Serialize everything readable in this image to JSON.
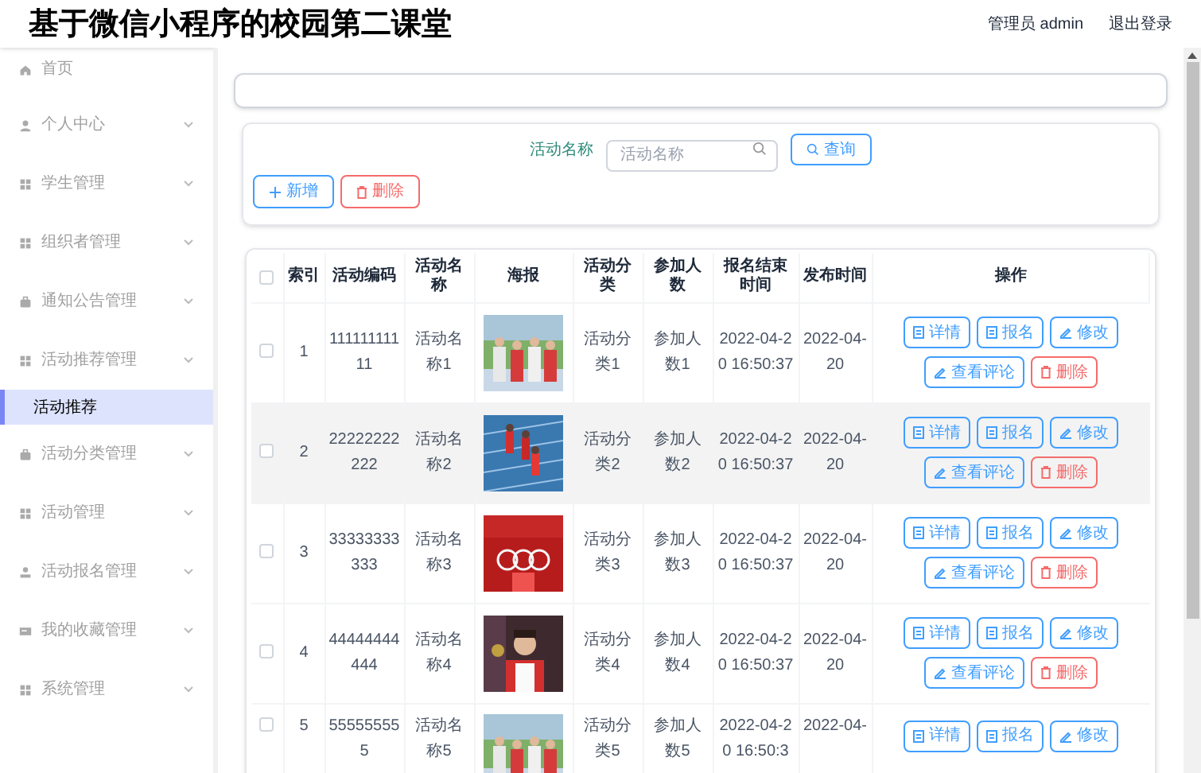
{
  "header": {
    "title": "基于微信小程序的校园第二课堂",
    "user": "管理员 admin",
    "logout": "退出登录"
  },
  "sidebar": {
    "items": [
      {
        "label": "首页",
        "kind": "home",
        "expandable": false
      },
      {
        "label": "个人中心",
        "kind": "user",
        "expandable": true
      },
      {
        "label": "学生管理",
        "kind": "grid",
        "expandable": true
      },
      {
        "label": "组织者管理",
        "kind": "grid",
        "expandable": true
      },
      {
        "label": "通知公告管理",
        "kind": "bag",
        "expandable": true
      },
      {
        "label": "活动推荐管理",
        "kind": "grid",
        "expandable": true,
        "children": [
          {
            "label": "活动推荐",
            "selected": true
          }
        ]
      },
      {
        "label": "活动分类管理",
        "kind": "bag",
        "expandable": true
      },
      {
        "label": "活动管理",
        "kind": "grid",
        "expandable": true
      },
      {
        "label": "活动报名管理",
        "kind": "person",
        "expandable": true
      },
      {
        "label": "我的收藏管理",
        "kind": "card",
        "expandable": true
      },
      {
        "label": "系统管理",
        "kind": "grid",
        "expandable": true
      }
    ]
  },
  "search": {
    "label": "活动名称",
    "placeholder": "活动名称",
    "button": "查询"
  },
  "toolbar": [
    {
      "label": "新增",
      "kind": "add"
    },
    {
      "label": "删除",
      "kind": "delete"
    }
  ],
  "table": {
    "select_all": {
      "checked": false
    },
    "columns": [
      "索引",
      "活动编码",
      "活动名称",
      "海报",
      "活动分类",
      "参加人数",
      "报名结束时间",
      "发布时间",
      "操作"
    ],
    "rows": [
      {
        "checked": false,
        "highlighted": false,
        "index": "1",
        "code": "11111111111",
        "name": "活动名称1",
        "category": "活动分类1",
        "participants": "参加人数1",
        "deadline": "2022-04-20 16:50:37",
        "published": "2022-04-20",
        "actions": [
          {
            "label": "详情",
            "kind": "detail"
          },
          {
            "label": "报名",
            "kind": "detail"
          },
          {
            "label": "修改",
            "kind": "edit"
          },
          {
            "label": "查看评论",
            "kind": "edit"
          },
          {
            "label": "删除",
            "kind": "delete"
          }
        ]
      },
      {
        "checked": false,
        "highlighted": true,
        "index": "2",
        "code": "22222222222",
        "name": "活动名称2",
        "category": "活动分类2",
        "participants": "参加人数2",
        "deadline": "2022-04-20 16:50:37",
        "published": "2022-04-20",
        "actions": [
          {
            "label": "详情",
            "kind": "detail"
          },
          {
            "label": "报名",
            "kind": "detail"
          },
          {
            "label": "修改",
            "kind": "edit"
          },
          {
            "label": "查看评论",
            "kind": "edit"
          },
          {
            "label": "删除",
            "kind": "delete"
          }
        ]
      },
      {
        "checked": false,
        "highlighted": false,
        "index": "3",
        "code": "33333333333",
        "name": "活动名称3",
        "category": "活动分类3",
        "participants": "参加人数3",
        "deadline": "2022-04-20 16:50:37",
        "published": "2022-04-20",
        "actions": [
          {
            "label": "详情",
            "kind": "detail"
          },
          {
            "label": "报名",
            "kind": "detail"
          },
          {
            "label": "修改",
            "kind": "edit"
          },
          {
            "label": "查看评论",
            "kind": "edit"
          },
          {
            "label": "删除",
            "kind": "delete"
          }
        ]
      },
      {
        "checked": false,
        "highlighted": false,
        "index": "4",
        "code": "44444444444",
        "name": "活动名称4",
        "category": "活动分类4",
        "participants": "参加人数4",
        "deadline": "2022-04-20 16:50:37",
        "published": "2022-04-20",
        "actions": [
          {
            "label": "详情",
            "kind": "detail"
          },
          {
            "label": "报名",
            "kind": "detail"
          },
          {
            "label": "修改",
            "kind": "edit"
          },
          {
            "label": "查看评论",
            "kind": "edit"
          },
          {
            "label": "删除",
            "kind": "delete"
          }
        ]
      },
      {
        "checked": false,
        "highlighted": false,
        "index": "5",
        "code": "555555555",
        "name": "活动名称5",
        "category": "活动分类5",
        "participants": "参加人数5",
        "deadline": "2022-04-20 16:50:3",
        "published": "2022-04-",
        "actions": [
          {
            "label": "详情",
            "kind": "detail"
          },
          {
            "label": "报名",
            "kind": "detail"
          },
          {
            "label": "修改",
            "kind": "edit"
          }
        ]
      }
    ]
  }
}
